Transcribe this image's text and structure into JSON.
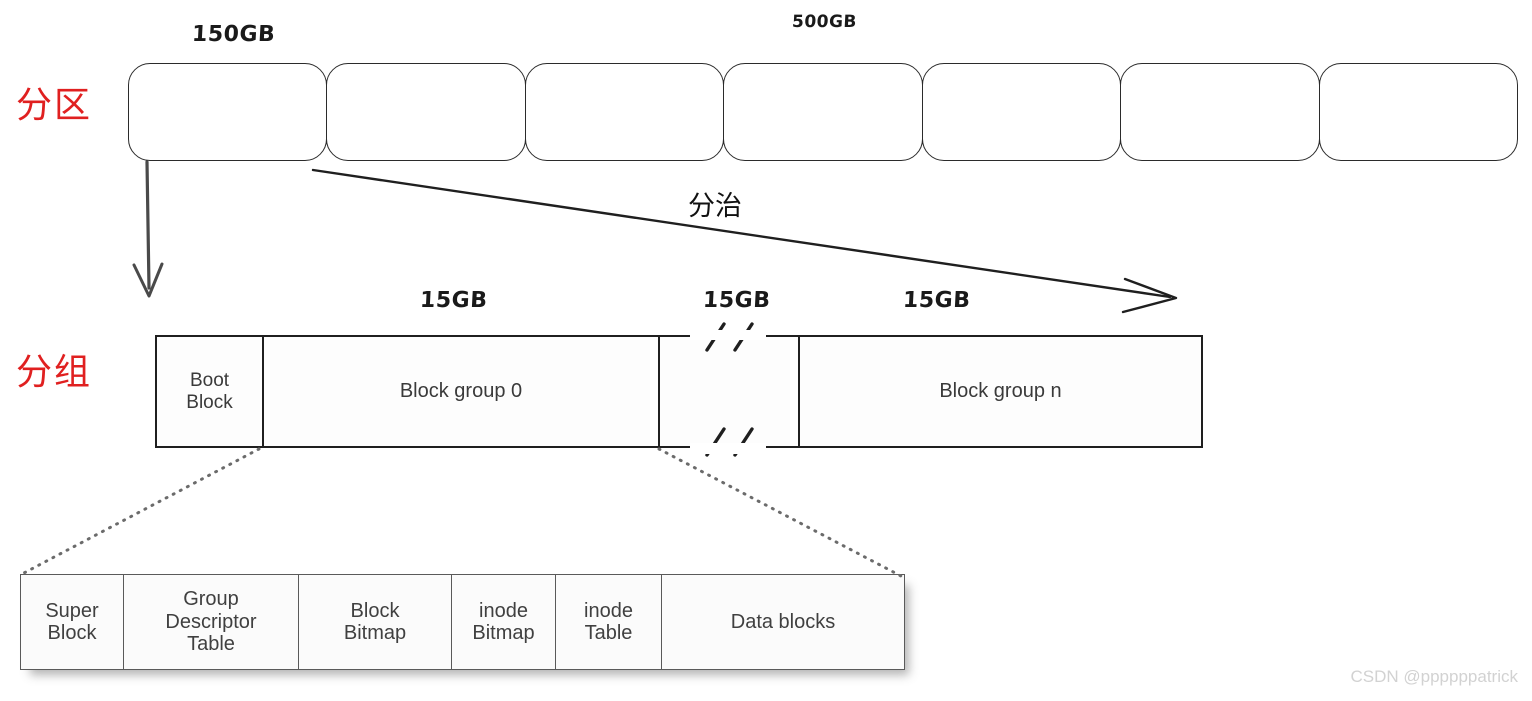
{
  "diagram": {
    "sections": {
      "partition": {
        "label": "分区"
      },
      "group": {
        "label": "分组"
      }
    },
    "captions": {
      "partition_size_left": "150GB",
      "partition_size_right": "500GB",
      "group_size_0": "15GB",
      "group_size_mid": "15GB",
      "group_size_n": "15GB",
      "divide_and_conquer": "分治"
    },
    "partition_row": {
      "box_count": 7,
      "boxes": [
        "",
        "",
        "",
        "",
        "",
        "",
        ""
      ]
    },
    "group_row": {
      "cells": [
        {
          "name": "boot-block",
          "label": "Boot\nBlock"
        },
        {
          "name": "block-group-0",
          "label": "Block group 0"
        },
        {
          "name": "gap",
          "label": ""
        },
        {
          "name": "block-group-n",
          "label": "Block group n"
        }
      ],
      "boot_block_line1": "Boot",
      "boot_block_line2": "Block",
      "block_group_0": "Block group 0",
      "block_group_n": "Block group n"
    },
    "detail_row": {
      "cells": [
        {
          "name": "super-block",
          "line1": "Super",
          "line2": "Block"
        },
        {
          "name": "group-descriptor-table",
          "line1": "Group",
          "line2": "Descriptor",
          "line3": "Table"
        },
        {
          "name": "block-bitmap",
          "line1": "Block",
          "line2": "Bitmap"
        },
        {
          "name": "inode-bitmap",
          "line1": "inode",
          "line2": "Bitmap"
        },
        {
          "name": "inode-table",
          "line1": "inode",
          "line2": "Table"
        },
        {
          "name": "data-blocks",
          "line1": "Data blocks",
          "line2": ""
        }
      ]
    },
    "colors": {
      "section_label": "#e02020",
      "stroke": "#1f1f1f",
      "detail_stroke": "#5a5a5a",
      "watermark": "#d2d2d2"
    }
  },
  "watermark": {
    "text": "CSDN @ppppppatrick"
  }
}
